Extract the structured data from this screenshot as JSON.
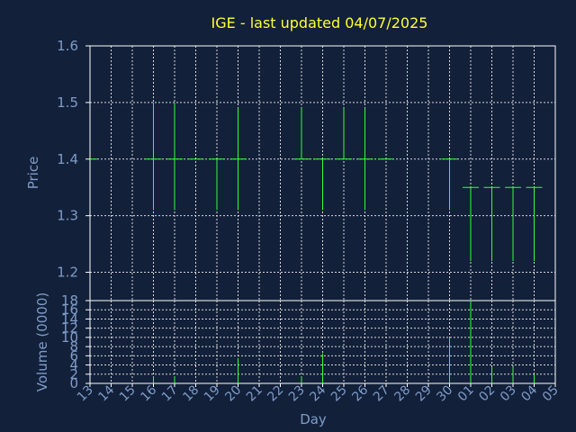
{
  "chart_data": [
    {
      "type": "candlestick",
      "title": "IGE - last updated 04/07/2025",
      "xlabel": "",
      "ylabel": "Price",
      "ylim": [
        1.15,
        1.6
      ],
      "yticks": [
        "1.2",
        "1.3",
        "1.4",
        "1.5",
        "1.6"
      ],
      "grid": true,
      "color": "#33ff33",
      "points": [
        {
          "day": "13",
          "open": 1.4,
          "close": 1.4,
          "high": 1.4,
          "low": 1.4
        },
        {
          "day": "16",
          "open": 1.4,
          "close": 1.4,
          "high": 1.5,
          "low": 1.31
        },
        {
          "day": "17",
          "open": 1.4,
          "close": 1.4,
          "high": 1.5,
          "low": 1.31
        },
        {
          "day": "18",
          "open": 1.4,
          "close": 1.4,
          "high": 1.4,
          "low": 1.4
        },
        {
          "day": "19",
          "open": 1.4,
          "close": 1.4,
          "high": 1.4,
          "low": 1.31
        },
        {
          "day": "20",
          "open": 1.4,
          "close": 1.4,
          "high": 1.49,
          "low": 1.31
        },
        {
          "day": "23",
          "open": 1.4,
          "close": 1.4,
          "high": 1.49,
          "low": 1.4
        },
        {
          "day": "24",
          "open": 1.4,
          "close": 1.4,
          "high": 1.4,
          "low": 1.31
        },
        {
          "day": "25",
          "open": 1.4,
          "close": 1.4,
          "high": 1.49,
          "low": 1.4
        },
        {
          "day": "26",
          "open": 1.4,
          "close": 1.4,
          "high": 1.49,
          "low": 1.31
        },
        {
          "day": "27",
          "open": 1.4,
          "close": 1.4,
          "high": 1.4,
          "low": 1.4
        },
        {
          "day": "30",
          "open": 1.4,
          "close": 1.4,
          "high": 1.4,
          "low": 1.31
        },
        {
          "day": "01",
          "open": 1.35,
          "close": 1.35,
          "high": 1.35,
          "low": 1.22
        },
        {
          "day": "02",
          "open": 1.35,
          "close": 1.35,
          "high": 1.35,
          "low": 1.22
        },
        {
          "day": "03",
          "open": 1.35,
          "close": 1.35,
          "high": 1.35,
          "low": 1.22
        },
        {
          "day": "04",
          "open": 1.35,
          "close": 1.35,
          "high": 1.35,
          "low": 1.22
        }
      ]
    },
    {
      "type": "bar",
      "xlabel": "Day",
      "ylabel": "Volume (0000)",
      "ylim": [
        0,
        18
      ],
      "yticks": [
        "0",
        "2",
        "4",
        "6",
        "8",
        "10",
        "12",
        "14",
        "16",
        "18"
      ],
      "grid": true,
      "color": "#33ff33",
      "categories": [
        "13",
        "14",
        "15",
        "16",
        "17",
        "18",
        "19",
        "20",
        "21",
        "22",
        "23",
        "24",
        "25",
        "26",
        "27",
        "28",
        "29",
        "30",
        "01",
        "02",
        "03",
        "04",
        "05"
      ],
      "values": [
        0,
        0,
        0,
        1.5,
        1.5,
        0,
        0,
        5.5,
        0,
        0,
        1.5,
        6.5,
        0,
        0,
        0,
        0,
        0,
        10,
        18,
        3.5,
        3.5,
        2,
        0
      ]
    }
  ]
}
